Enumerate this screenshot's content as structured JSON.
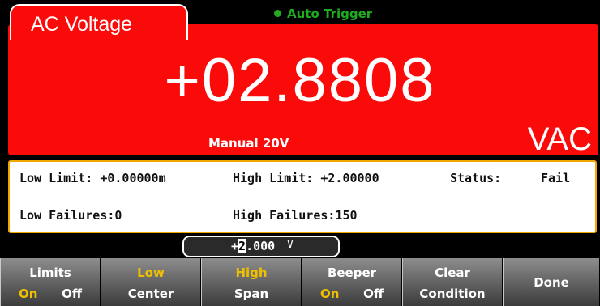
{
  "header": {
    "mode_label": "AC Voltage",
    "trigger_label": "Auto Trigger",
    "trigger_color": "#1faa1f"
  },
  "measurement": {
    "reading": "+02.8808",
    "range": "Manual 20V",
    "unit": "VAC",
    "panel_color": "#fb0a0a"
  },
  "limits_info": {
    "low_limit": "Low Limit: +0.00000m",
    "high_limit": "High Limit: +2.00000",
    "status_label": "Status:",
    "status_value": "Fail",
    "low_failures": "Low Failures:0",
    "high_failures": "High Failures:150"
  },
  "entry": {
    "value_prefix": "+",
    "cursor_digit": "2",
    "value_rest": ".000",
    "unit": "V"
  },
  "softkeys": {
    "limits": {
      "label": "Limits",
      "on": "On",
      "off": "Off"
    },
    "low_center": {
      "top": "Low",
      "bottom": "Center"
    },
    "high_span": {
      "top": "High",
      "bottom": "Span"
    },
    "beeper": {
      "label": "Beeper",
      "on": "On",
      "off": "Off"
    },
    "clear_condition": {
      "top": "Clear",
      "bottom": "Condition"
    },
    "done": {
      "label": "Done"
    },
    "highlight_color": "#f0c000"
  }
}
